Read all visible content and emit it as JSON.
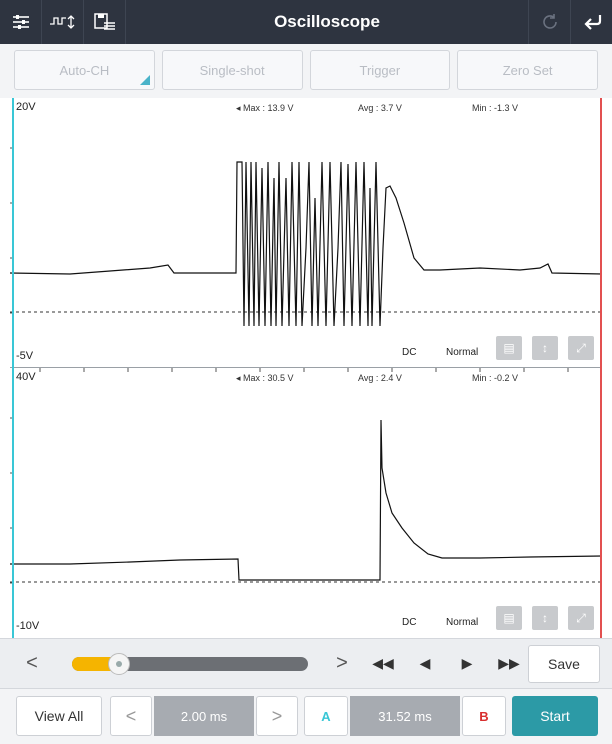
{
  "app": {
    "title": "Oscilloscope"
  },
  "toolbar": {
    "icons": [
      "settings-sliders-icon",
      "waveform-mode-icon",
      "save-list-icon"
    ],
    "right_icons": [
      "refresh-icon",
      "back-icon"
    ]
  },
  "function_buttons": [
    {
      "label": "Auto-CH"
    },
    {
      "label": "Single-shot"
    },
    {
      "label": "Trigger"
    },
    {
      "label": "Zero Set"
    }
  ],
  "channels": [
    {
      "scale_top": "20V",
      "scale_bottom": "-5V",
      "max": "Max : 13.9 V",
      "avg": "Avg : 3.7 V",
      "min": "Min : -1.3 V",
      "coupling": "DC",
      "trigger_mode": "Normal"
    },
    {
      "scale_top": "40V",
      "scale_bottom": "-10V",
      "max": "Max : 30.5 V",
      "avg": "Avg : 2.4 V",
      "min": "Min : -0.2 V",
      "coupling": "DC",
      "trigger_mode": "Normal"
    }
  ],
  "playback": {
    "prev": "<",
    "next": ">",
    "slider_value": 0.2,
    "save_label": "Save"
  },
  "bottom": {
    "view_all": "View All",
    "time_div": "2.00 ms",
    "marker_a": "A",
    "delta": "31.52 ms",
    "marker_b": "B",
    "start_label": "Start"
  },
  "colors": {
    "topbar": "#2e3440",
    "cursor_a": "#39c7d6",
    "cursor_b": "#e25050",
    "slider_fill": "#f5b400",
    "start_button": "#2c9aa6"
  }
}
